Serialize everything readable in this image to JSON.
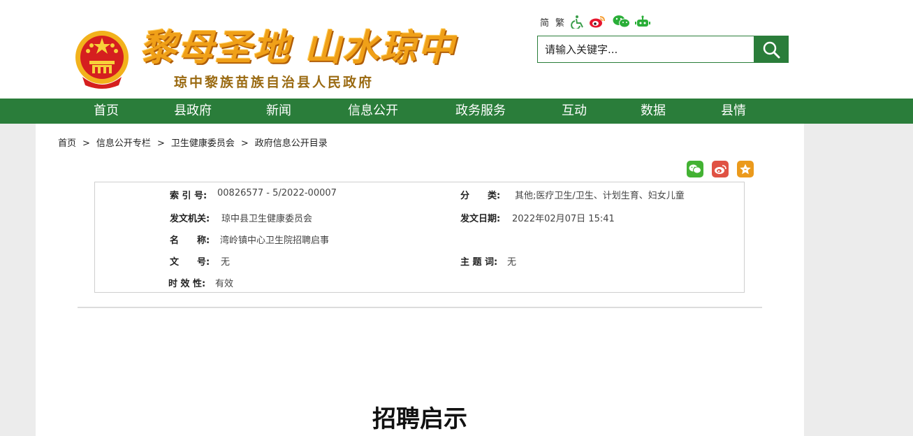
{
  "header": {
    "slogan": "黎母圣地 山水琼中",
    "gov_name": "琼中黎族苗族自治县人民政府",
    "tools": {
      "simplified": "简",
      "traditional": "繁",
      "icons": [
        "accessibility-icon",
        "weibo-icon",
        "wechat-icon",
        "robot-icon"
      ]
    },
    "search": {
      "placeholder": "请输入关键字..."
    }
  },
  "nav": {
    "items": [
      "首页",
      "县政府",
      "新闻",
      "信息公开",
      "政务服务",
      "互动",
      "数据",
      "县情"
    ]
  },
  "breadcrumb": {
    "items": [
      "首页",
      "信息公开专栏",
      "卫生健康委员会",
      "政府信息公开目录"
    ],
    "separator": ">"
  },
  "share": [
    "wechat-icon",
    "weibo-icon",
    "favorite-icon"
  ],
  "info": {
    "index_label": "索 引 号:",
    "index_value": "00826577 - 5/2022-00007",
    "category_label": "分　　类:",
    "category_value": "其他;医疗卫生/卫生、计划生育、妇女儿童",
    "issuer_label": "发文机关:",
    "issuer_value": "琼中县卫生健康委员会",
    "date_label": "发文日期:",
    "date_value": "2022年02月07日 15:41",
    "name_label": "名　　称:",
    "name_value": "湾岭镇中心卫生院招聘启事",
    "docno_label": "文　　号:",
    "docno_value": "无",
    "subject_label": "主 题 词:",
    "subject_value": "无",
    "validity_label": "时 效 性:",
    "validity_value": "有效"
  },
  "article": {
    "title": "招聘启示"
  },
  "colors": {
    "green": "#2a7d3a",
    "gold": "#f0a018",
    "brown": "#9a6a12"
  }
}
